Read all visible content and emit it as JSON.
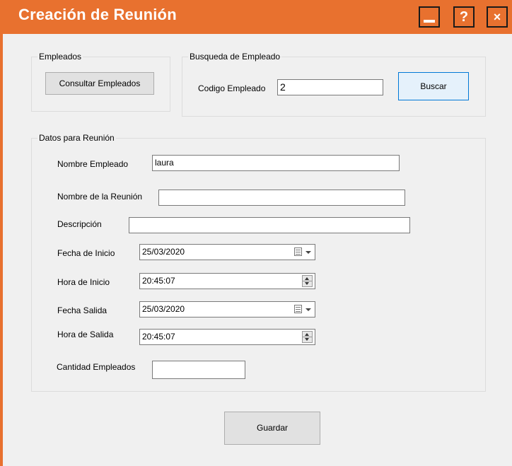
{
  "window": {
    "title": "Creación de Reunión"
  },
  "titlebar": {
    "help_label": "?",
    "close_label": "×"
  },
  "colors": {
    "accent": "#e8712f",
    "background": "#f0f0f0"
  },
  "empleados_group": {
    "legend": "Empleados",
    "consultar_label": "Consultar Empleados"
  },
  "busqueda_group": {
    "legend": "Busqueda de Empleado",
    "codigo_label": "Codigo Empleado",
    "codigo_value": "2",
    "buscar_label": "Buscar"
  },
  "datos_group": {
    "legend": "Datos para Reunión",
    "nombre_empleado_label": "Nombre Empleado",
    "nombre_empleado_value": "laura",
    "nombre_reunion_label": "Nombre de la Reunión",
    "nombre_reunion_value": "",
    "descripcion_label": "Descripción",
    "descripcion_value": "",
    "fecha_inicio_label": "Fecha de Inicio",
    "fecha_inicio_value": "25/03/2020",
    "hora_inicio_label": "Hora de Inicio",
    "hora_inicio_value": "20:45:07",
    "fecha_salida_label": "Fecha Salida",
    "fecha_salida_value": "25/03/2020",
    "hora_salida_label": "Hora de Salida",
    "hora_salida_value": "20:45:07",
    "cantidad_label": "Cantidad Empleados",
    "cantidad_value": ""
  },
  "actions": {
    "guardar_label": "Guardar"
  },
  "icons": {
    "minimize": "minimize-icon",
    "help": "help-icon",
    "close": "close-icon",
    "calendar": "calendar-icon",
    "spinner": "spinner-icon"
  }
}
